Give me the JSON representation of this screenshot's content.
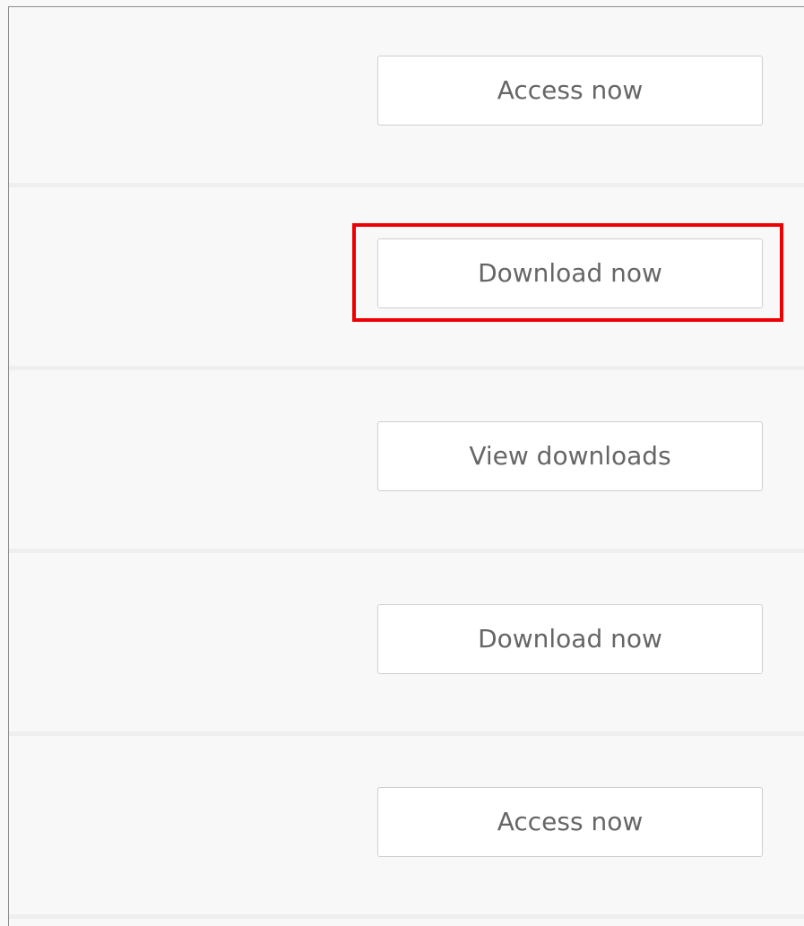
{
  "accent_colors": {
    "highlight": "#ee0000",
    "button_text": "#666666",
    "button_border": "#cfcfcf"
  },
  "rows": [
    {
      "button_label": "Access now"
    },
    {
      "button_label": "Download now"
    },
    {
      "button_label": "View downloads"
    },
    {
      "button_label": "Download now"
    },
    {
      "button_label": "Access now"
    }
  ]
}
